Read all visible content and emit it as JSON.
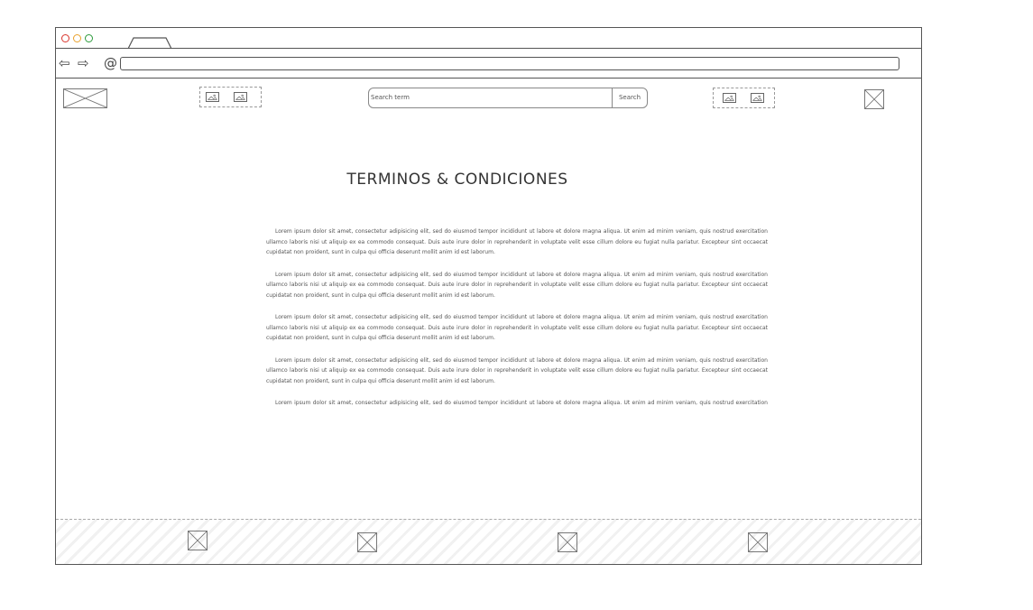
{
  "browser": {
    "address": ""
  },
  "header": {
    "search": {
      "placeholder": "Search term",
      "button_label": "Search"
    }
  },
  "main": {
    "title": "TERMINOS & CONDICIONES",
    "paragraphs": [
      "Lorem ipsum dolor sit amet, consectetur adipisicing elit, sed do eiusmod tempor incididunt ut labore et dolore magna aliqua. Ut enim ad minim veniam, quis nostrud exercitation ullamco laboris nisi ut aliquip ex ea commodo consequat. Duis aute irure dolor in reprehenderit in voluptate velit esse cillum dolore eu fugiat nulla pariatur. Excepteur sint occaecat cupidatat non proident, sunt in culpa qui officia deserunt mollit anim id est laborum.",
      "Lorem ipsum dolor sit amet, consectetur adipisicing elit, sed do eiusmod tempor incididunt ut labore et dolore magna aliqua. Ut enim ad minim veniam, quis nostrud exercitation ullamco laboris nisi ut aliquip ex ea commodo consequat. Duis aute irure dolor in reprehenderit in voluptate velit esse cillum dolore eu fugiat nulla pariatur. Excepteur sint occaecat cupidatat non proident, sunt in culpa qui officia deserunt mollit anim id est laborum.",
      "Lorem ipsum dolor sit amet, consectetur adipisicing elit, sed do eiusmod tempor incididunt ut labore et dolore magna aliqua. Ut enim ad minim veniam, quis nostrud exercitation ullamco laboris nisi ut aliquip ex ea commodo consequat. Duis aute irure dolor in reprehenderit in voluptate velit esse cillum dolore eu fugiat nulla pariatur. Excepteur sint occaecat cupidatat non proident, sunt in culpa qui officia deserunt mollit anim id est laborum.",
      "Lorem ipsum dolor sit amet, consectetur adipisicing elit, sed do eiusmod tempor incididunt ut labore et dolore magna aliqua. Ut enim ad minim veniam, quis nostrud exercitation ullamco laboris nisi ut aliquip ex ea commodo consequat. Duis aute irure dolor in reprehenderit in voluptate velit esse cillum dolore eu fugiat nulla pariatur. Excepteur sint occaecat cupidatat non proident, sunt in culpa qui officia deserunt mollit anim id est laborum.",
      "Lorem ipsum dolor sit amet, consectetur adipisicing elit, sed do eiusmod tempor incididunt ut labore et dolore magna aliqua. Ut enim ad minim veniam, quis nostrud exercitation ullamco laboris nisi ut aliquip ex ea commodo consequat."
    ]
  },
  "colors": {
    "close_dot": "#d9342b",
    "minimize_dot": "#e9a12b",
    "maximize_dot": "#2b9a3a",
    "outline": "#555555"
  },
  "icons": {
    "back": "back-arrow-icon",
    "forward": "forward-arrow-icon",
    "reload": "reload-icon",
    "logo": "logo-placeholder-icon",
    "image": "image-icon",
    "placeholder": "placeholder-box-icon"
  }
}
